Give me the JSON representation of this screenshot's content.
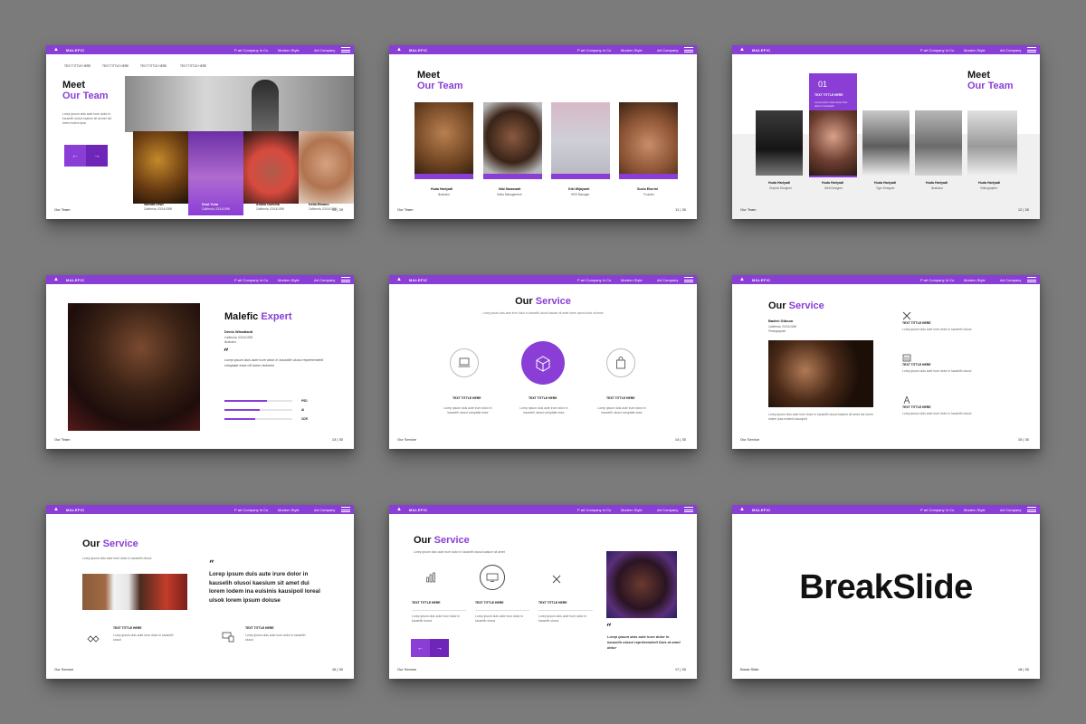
{
  "theme": {
    "accent": "#8a3ed6",
    "background": "#7b7b7b"
  },
  "topbar": {
    "brand": "MALEFIC",
    "nav1": "P art Company In Co",
    "nav2": "Modern Style",
    "nav3": "Art Company",
    "logo_icon": "logo-mark-icon",
    "menu_icon": "hamburger-menu-icon"
  },
  "slide1": {
    "tabs": [
      "TEXT TITTLE HERE",
      "TEXT TITTLE HERE",
      "TEXT TITTLE HERE",
      "TEXT TITTLE HERE"
    ],
    "title_line1": "Meet",
    "title_line2": "Our Team",
    "para": "Lorep ipsum duis aute irure dolor in kauselih olusoi kasium sit anmet dui lorem lodem ipsa",
    "members": [
      {
        "name": "Sandra Dewi",
        "role": "California, 03/14/1990"
      },
      {
        "name": "Dewi Yuna",
        "role": "California, 03/14/1990"
      },
      {
        "name": "Ariana Nurbina",
        "role": "California, 03/14/1990"
      },
      {
        "name": "Delia Ehsanu",
        "role": "California, 03/14/1990"
      }
    ],
    "footer": "Our Team",
    "page": "10 | 30"
  },
  "slide2": {
    "title_line1": "Meet",
    "title_line2": "Our Team",
    "members": [
      {
        "name": "Huda Hariyadi",
        "role": "illustrator"
      },
      {
        "name": "Nial Saraswati",
        "role": "Sales Management"
      },
      {
        "name": "Kiki Wijayanti",
        "role": "HRD Manager"
      },
      {
        "name": "Susio Ekorini",
        "role": "Founder"
      }
    ],
    "footer": "Our Team",
    "page": "11 | 30"
  },
  "slide3": {
    "title_line1": "Meet",
    "title_line2": "Our Team",
    "number": "01",
    "number_title": "TEXT TITTLE HERE",
    "number_para": "Lorep ipsum duis aute irure dolor in kauselih",
    "members": [
      {
        "name": "Huda Hariyadi",
        "role": "Graphic Designer"
      },
      {
        "name": "Huda Hariyadi",
        "role": "Web Designer"
      },
      {
        "name": "Huda Hariyadi",
        "role": "Type Designer"
      },
      {
        "name": "Huda Hariyadi",
        "role": "illustrator"
      },
      {
        "name": "Huda Hariyadi",
        "role": "Videographer"
      }
    ],
    "footer": "Our Team",
    "page": "12 | 30"
  },
  "slide4": {
    "title_a": "Malefic ",
    "title_b": "Expert",
    "name": "Denis Wiradianti",
    "meta1": "California, 03/14/1993",
    "meta2": "illustrator",
    "quote_mark": "“",
    "quote": "Lorep ipsum duis aute irure dolor in kauselih olusoi reprehenderit voluptate esse cill lorem dolorem",
    "skills": [
      {
        "label": "PSD",
        "value": 0.62
      },
      {
        "label": "AI",
        "value": 0.52
      },
      {
        "label": "CDR",
        "value": 0.45
      }
    ],
    "footer": "Our Team",
    "page": "13 | 30"
  },
  "slide5": {
    "title_a": "Our ",
    "title_b": "Service",
    "subtitle": "Lorep ipsum duis aute irure dolor in kauselih olusoi kasium sit amet lorem ipsum dolor sit amet",
    "services": [
      {
        "title": "TEXT TITTLE HERE",
        "para": "Lorep ipsum duis aute irure dolor in kauselih olusoi voluptate esse",
        "icon": "laptop-icon"
      },
      {
        "title": "TEXT TITTLE HERE",
        "para": "Lorep ipsum duis aute irure dolor in kauselih olusoi voluptate esse",
        "icon": "box-icon"
      },
      {
        "title": "TEXT TITTLE HERE",
        "para": "Lorep ipsum duis aute irure dolor in kauselih olusoi voluptate esse",
        "icon": "shopping-bag-icon"
      }
    ],
    "footer": "Our Service",
    "page": "14 | 30"
  },
  "slide6": {
    "title_a": "Our ",
    "title_b": "Service",
    "name": "Badrei Gibson",
    "meta1": "California, 03/14/1990",
    "meta2": "Photographer",
    "para": "Lorep ipsum duis aute irure dolor in kauselih olusoi kasium sit amet dui lorem lodem ipsa euisinis kausipoil",
    "items": [
      {
        "title": "TEXT TITTLE HERE",
        "para": "Lorep ipsum duis aute irure dolor in kauselih olusoi",
        "icon": "tools-icon"
      },
      {
        "title": "TEXT TITTLE HERE",
        "para": "Lorep ipsum duis aute irure dolor in kauselih olusoi",
        "icon": "building-icon"
      },
      {
        "title": "TEXT TITTLE HERE",
        "para": "Lorep ipsum duis aute irure dolor in kauselih olusoi",
        "icon": "compass-icon"
      }
    ],
    "footer": "Our Service",
    "page": "15 | 30"
  },
  "slide7": {
    "title_a": "Our ",
    "title_b": "Service",
    "para": "Lorep ipsum duis aute irure dolor in kauselih olusoi",
    "quote_mark": "“",
    "quote": "Lorep ipsum duis aute irure dolor in kauselih olusoi kaesium sit amet dui lorem lodem ina euisinis kausipoil loreal uisok lorem ipsum doiuse",
    "items": [
      {
        "title": "TEXT TITTLE HERE",
        "para": "Lorep ipsum duis aute irure dolor in kauselih olusoi",
        "icon": "handshake-icon"
      },
      {
        "title": "TEXT TITTLE HERE",
        "para": "Lorep ipsum duis aute irure dolor in kauselih olusoi",
        "icon": "devices-icon"
      }
    ],
    "footer": "Our Service",
    "page": "16 | 30"
  },
  "slide8": {
    "title_a": "Our ",
    "title_b": "Service",
    "subtitle": "Lorep ipsum duis aute irure dolor in kauselih olusoi kasium sit amet",
    "items": [
      {
        "title": "TEXT TITTLE HERE",
        "para": "Lorep ipsum duis aute irure dolor in kauselih olusoi",
        "icon": "chart-icon"
      },
      {
        "title": "TEXT TITTLE HERE",
        "para": "Lorep ipsum duis aute irure dolor in kauselih olusoi",
        "icon": "monitor-icon"
      },
      {
        "title": "TEXT TITTLE HERE",
        "para": "Lorep ipsum duis aute irure dolor in kauselih olusoi",
        "icon": "tools-icon"
      }
    ],
    "quote_mark": "“",
    "quote": "Lorep ipsum duis aute irure dolor in kauselih olusoi reprehenderit Duis at amet dolor",
    "footer": "Our Service",
    "page": "17 | 30"
  },
  "slide9": {
    "title": "BreakSlide",
    "footer": "Break Slide",
    "page": "18 | 30"
  }
}
